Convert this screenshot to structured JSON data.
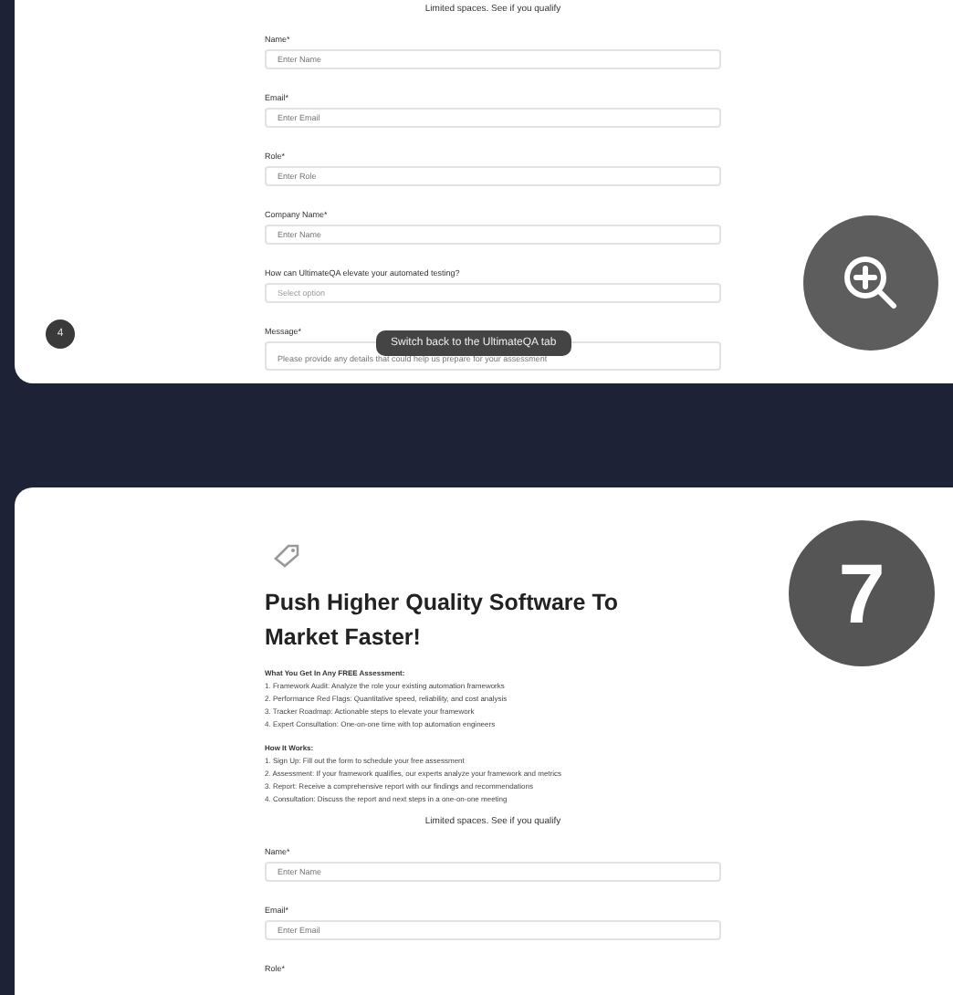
{
  "top_card": {
    "notice": "Limited spaces. See if you qualify",
    "fields": [
      {
        "kind": "input",
        "label": "Name*",
        "placeholder": "Enter Name"
      },
      {
        "kind": "input",
        "label": "Email*",
        "placeholder": "Enter Email"
      },
      {
        "kind": "input",
        "label": "Role*",
        "placeholder": "Enter Role"
      },
      {
        "kind": "input",
        "label": "Company Name*",
        "placeholder": "Enter Name"
      },
      {
        "kind": "select",
        "label": "How can UltimateQA elevate your automated testing?",
        "placeholder": "Select option"
      },
      {
        "kind": "textarea",
        "label": "Message*",
        "placeholder": "Please provide any details that could help us prepare for your assessment"
      }
    ],
    "tooltip": "Switch back to the UltimateQA tab",
    "step_badge": "4"
  },
  "bottom_card": {
    "step_number": "7",
    "title": "Push Higher Quality Software To Market Faster!",
    "sections": [
      {
        "heading": "What You Get In Any FREE Assessment:",
        "items": [
          "1. Framework Audit: Analyze the role your existing automation frameworks",
          "2. Performance Red Flags: Quantitative speed, reliability, and cost analysis",
          "3. Tracker Roadmap: Actionable steps to elevate your framework",
          "4. Expert Consultation: One-on-one time with top automation engineers"
        ]
      },
      {
        "heading": "How It Works:",
        "items": [
          "1. Sign Up: Fill out the form to schedule your free assessment",
          "2. Assessment: If your framework qualifies, our experts analyze your framework and metrics",
          "3. Report: Receive a comprehensive report with our findings and recommendations",
          "4. Consultation: Discuss the report and next steps in a one-on-one meeting"
        ]
      }
    ],
    "notice": "Limited spaces. See if you qualify",
    "fields": [
      {
        "kind": "input",
        "label": "Name*",
        "placeholder": "Enter Name"
      },
      {
        "kind": "input",
        "label": "Email*",
        "placeholder": "Enter Email"
      },
      {
        "kind": "label",
        "label": "Role*"
      }
    ]
  }
}
